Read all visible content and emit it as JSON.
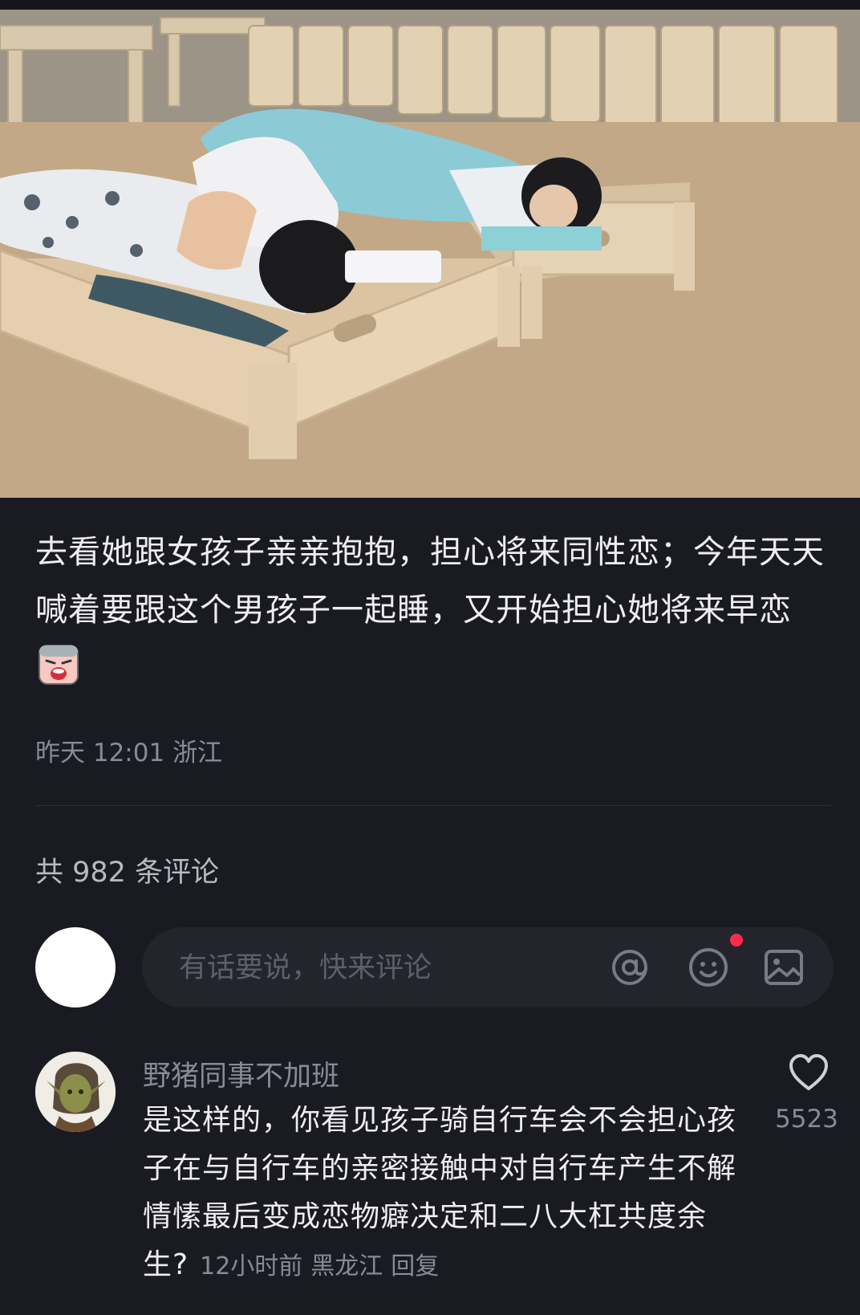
{
  "post": {
    "text": "去看她跟女孩子亲亲抱抱，担心将来同性恋；今年天天喊着要跟这个男孩子一起睡，又开始担心她将来早恋",
    "time": "昨天 12:01",
    "location": "浙江"
  },
  "comments_header": {
    "text": "共 982 条评论"
  },
  "comment_input": {
    "placeholder": "有话要说，快来评论"
  },
  "comment": {
    "username": "野猪同事不加班",
    "text": "是这样的，你看见孩子骑自行车会不会担心孩子在与自行车的亲密接触中对自行车产生不解情愫最后变成恋物癖决定和二八大杠共度余生?",
    "time": "12小时前",
    "location": "黑龙江",
    "reply_label": "回复",
    "like_count": "5523"
  },
  "icons": {
    "at": "at-icon",
    "emoji": "emoji-icon",
    "image": "image-icon",
    "like": "heart-icon",
    "post_emoji": "crying-face-icon"
  },
  "colors": {
    "background": "#1a1a22",
    "input_bg": "#24242d",
    "secondary_text": "#8a8a94",
    "notification_dot": "#ff2b4a"
  }
}
